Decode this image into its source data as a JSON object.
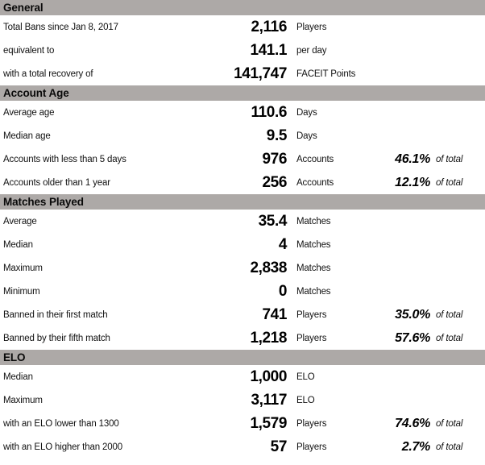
{
  "report": {
    "colors": {
      "section_header_bg": "#ada9a7",
      "row_bg": "#ffffff",
      "text": "#000000"
    },
    "sections": [
      {
        "title": "General",
        "rows": [
          {
            "label": "Total Bans since Jan 8, 2017",
            "value": "2,116",
            "unit": "Players",
            "percent": "",
            "percent_label": ""
          },
          {
            "label": "equivalent to",
            "value": "141.1",
            "unit": "per day",
            "percent": "",
            "percent_label": ""
          },
          {
            "label": "with a total recovery of",
            "value": "141,747",
            "unit": "FACEIT Points",
            "percent": "",
            "percent_label": ""
          }
        ]
      },
      {
        "title": "Account Age",
        "rows": [
          {
            "label": "Average age",
            "value": "110.6",
            "unit": "Days",
            "percent": "",
            "percent_label": ""
          },
          {
            "label": "Median age",
            "value": "9.5",
            "unit": "Days",
            "percent": "",
            "percent_label": ""
          },
          {
            "label": "Accounts with less than 5 days",
            "value": "976",
            "unit": "Accounts",
            "percent": "46.1%",
            "percent_label": "of total"
          },
          {
            "label": "Accounts older than 1 year",
            "value": "256",
            "unit": "Accounts",
            "percent": "12.1%",
            "percent_label": "of total"
          }
        ]
      },
      {
        "title": "Matches Played",
        "rows": [
          {
            "label": "Average",
            "value": "35.4",
            "unit": "Matches",
            "percent": "",
            "percent_label": ""
          },
          {
            "label": "Median",
            "value": "4",
            "unit": "Matches",
            "percent": "",
            "percent_label": ""
          },
          {
            "label": "Maximum",
            "value": "2,838",
            "unit": "Matches",
            "percent": "",
            "percent_label": ""
          },
          {
            "label": "Minimum",
            "value": "0",
            "unit": "Matches",
            "percent": "",
            "percent_label": ""
          },
          {
            "label": "Banned in their first match",
            "value": "741",
            "unit": "Players",
            "percent": "35.0%",
            "percent_label": "of total"
          },
          {
            "label": "Banned by their fifth match",
            "value": "1,218",
            "unit": "Players",
            "percent": "57.6%",
            "percent_label": "of total"
          }
        ]
      },
      {
        "title": "ELO",
        "rows": [
          {
            "label": "Median",
            "value": "1,000",
            "unit": "ELO",
            "percent": "",
            "percent_label": ""
          },
          {
            "label": "Maximum",
            "value": "3,117",
            "unit": "ELO",
            "percent": "",
            "percent_label": ""
          },
          {
            "label": "with an ELO lower than 1300",
            "value": "1,579",
            "unit": "Players",
            "percent": "74.6%",
            "percent_label": "of total"
          },
          {
            "label": "with an ELO higher than 2000",
            "value": "57",
            "unit": "Players",
            "percent": "2.7%",
            "percent_label": "of total"
          }
        ]
      }
    ]
  }
}
